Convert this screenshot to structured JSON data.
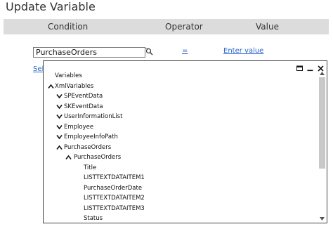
{
  "title": "Update Variable",
  "columns": {
    "condition": "Condition",
    "operator": "Operator",
    "value": "Value"
  },
  "row": {
    "condition_value": "PurchaseOrders",
    "operator_label": "=",
    "value_label": "Enter value",
    "select_label": "Sele"
  },
  "tree": [
    {
      "label": "Variables",
      "indent": 0,
      "chevron": "none"
    },
    {
      "label": "XmlVariables",
      "indent": 0,
      "chevron": "up"
    },
    {
      "label": "SPEventData",
      "indent": 1,
      "chevron": "down"
    },
    {
      "label": "SKEventData",
      "indent": 1,
      "chevron": "down"
    },
    {
      "label": "UserInformationList",
      "indent": 1,
      "chevron": "down"
    },
    {
      "label": "Employee",
      "indent": 1,
      "chevron": "down"
    },
    {
      "label": "EmployeeInfoPath",
      "indent": 1,
      "chevron": "down"
    },
    {
      "label": "PurchaseOrders",
      "indent": 1,
      "chevron": "up"
    },
    {
      "label": "PurchaseOrders",
      "indent": 2,
      "chevron": "up"
    },
    {
      "label": "Title",
      "indent": 3,
      "chevron": "none"
    },
    {
      "label": "LISTTEXTDATAITEM1",
      "indent": 3,
      "chevron": "none"
    },
    {
      "label": "PurchaseOrderDate",
      "indent": 3,
      "chevron": "none"
    },
    {
      "label": "LISTTEXTDATAITEM2",
      "indent": 3,
      "chevron": "none"
    },
    {
      "label": "LISTTEXTDATAITEM3",
      "indent": 3,
      "chevron": "none"
    },
    {
      "label": "Status",
      "indent": 3,
      "chevron": "none"
    }
  ],
  "popup_controls": [
    "maximize-icon",
    "minimize-icon",
    "close-icon"
  ],
  "scrollbar": {
    "position": 0.0,
    "visible_fraction": 0.6
  }
}
